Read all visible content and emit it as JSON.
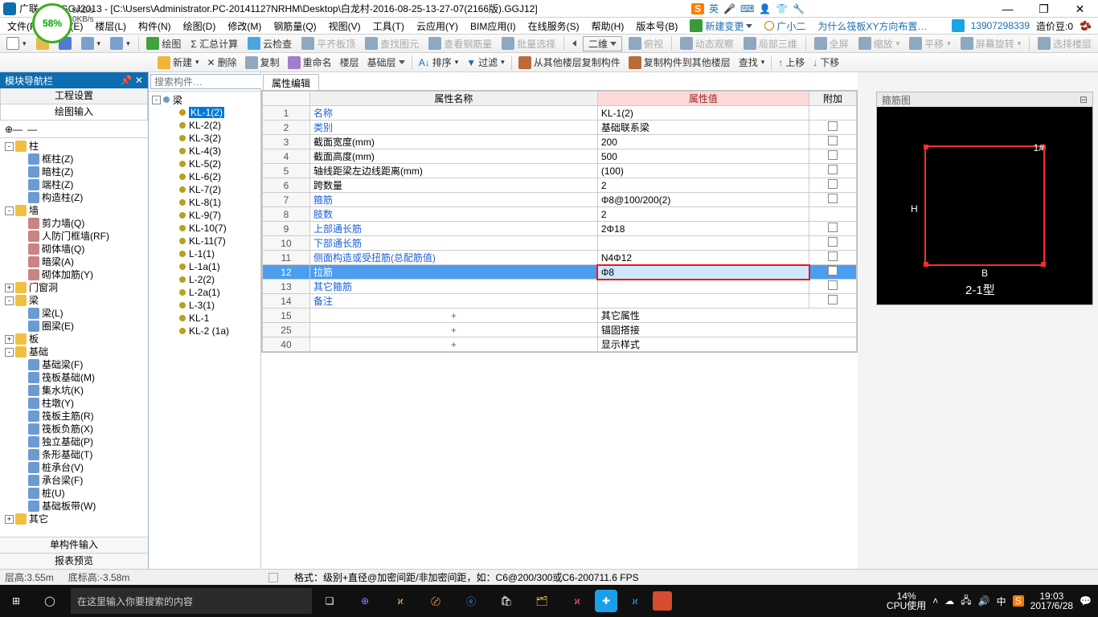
{
  "title": "广联…… GGJ2013 - [C:\\Users\\Administrator.PC-20141127NRHM\\Desktop\\白龙村-2016-08-25-13-27-07(2166版).GGJ12]",
  "speed": {
    "pct": "58%",
    "up": "0KB/s",
    "down": "0KB/s"
  },
  "ime": {
    "logo": "S",
    "lang": "英"
  },
  "menus": [
    "文件(F)",
    "编辑(E)",
    "楼层(L)",
    "构件(N)",
    "绘图(D)",
    "修改(M)",
    "钢筋量(Q)",
    "视图(V)",
    "工具(T)",
    "云应用(Y)",
    "BIM应用(I)",
    "在线服务(S)",
    "帮助(H)",
    "版本号(B)"
  ],
  "menu_actions": {
    "new": "新建变更",
    "user": "广小二",
    "tip": "为什么筏板XY方向布置…",
    "account": "13907298339",
    "credit": "造价豆:0"
  },
  "tb1": {
    "draw": "绘图",
    "sum": "Σ 汇总计算",
    "cloud": "云检查",
    "level": "平齐板顶",
    "find": "查找图元",
    "viewbar": "查看钢筋量",
    "batch": "批量选择",
    "mode": "二维",
    "top": "俯视",
    "dyn": "动态观察",
    "local3d": "局部三维",
    "full": "全屏",
    "zoom": "缩放",
    "pan": "平移",
    "rot": "屏幕旋转",
    "selfloor": "选择楼层"
  },
  "tb2": {
    "new": "新建",
    "del": "删除",
    "copy": "复制",
    "rename": "重命名",
    "floor": "楼层",
    "baselayer": "基础层",
    "sort": "排序",
    "filter": "过滤",
    "copyfrom": "从其他楼层复制构件",
    "copyto": "复制构件到其他楼层",
    "search": "查找",
    "up": "上移",
    "down": "下移"
  },
  "left_panel": {
    "title": "模块导航栏",
    "tab1": "工程设置",
    "tab2": "绘图输入",
    "bottom1": "单构件输入",
    "bottom2": "报表预览"
  },
  "tree": [
    {
      "lvl": 0,
      "exp": "-",
      "ico": "folder",
      "label": "柱"
    },
    {
      "lvl": 1,
      "ico": "obj",
      "label": "框柱(Z)"
    },
    {
      "lvl": 1,
      "ico": "obj",
      "label": "暗柱(Z)"
    },
    {
      "lvl": 1,
      "ico": "obj",
      "label": "端柱(Z)"
    },
    {
      "lvl": 1,
      "ico": "obj",
      "label": "构造柱(Z)"
    },
    {
      "lvl": 0,
      "exp": "-",
      "ico": "folder",
      "label": "墙"
    },
    {
      "lvl": 1,
      "ico": "p",
      "label": "剪力墙(Q)"
    },
    {
      "lvl": 1,
      "ico": "p",
      "label": "人防门框墙(RF)"
    },
    {
      "lvl": 1,
      "ico": "p",
      "label": "砌体墙(Q)"
    },
    {
      "lvl": 1,
      "ico": "p",
      "label": "暗梁(A)"
    },
    {
      "lvl": 1,
      "ico": "p",
      "label": "砌体加筋(Y)"
    },
    {
      "lvl": 0,
      "exp": "+",
      "ico": "folder",
      "label": "门窗洞"
    },
    {
      "lvl": 0,
      "exp": "-",
      "ico": "folder",
      "label": "梁"
    },
    {
      "lvl": 1,
      "ico": "obj",
      "label": "梁(L)"
    },
    {
      "lvl": 1,
      "ico": "obj",
      "label": "圈梁(E)"
    },
    {
      "lvl": 0,
      "exp": "+",
      "ico": "folder",
      "label": "板"
    },
    {
      "lvl": 0,
      "exp": "-",
      "ico": "folder",
      "label": "基础"
    },
    {
      "lvl": 1,
      "ico": "obj",
      "label": "基础梁(F)"
    },
    {
      "lvl": 1,
      "ico": "obj",
      "label": "筏板基础(M)"
    },
    {
      "lvl": 1,
      "ico": "obj",
      "label": "集水坑(K)"
    },
    {
      "lvl": 1,
      "ico": "obj",
      "label": "柱墩(Y)"
    },
    {
      "lvl": 1,
      "ico": "obj",
      "label": "筏板主筋(R)"
    },
    {
      "lvl": 1,
      "ico": "obj",
      "label": "筏板负筋(X)"
    },
    {
      "lvl": 1,
      "ico": "obj",
      "label": "独立基础(P)"
    },
    {
      "lvl": 1,
      "ico": "obj",
      "label": "条形基础(T)"
    },
    {
      "lvl": 1,
      "ico": "obj",
      "label": "桩承台(V)"
    },
    {
      "lvl": 1,
      "ico": "obj",
      "label": "承台梁(F)"
    },
    {
      "lvl": 1,
      "ico": "obj",
      "label": "桩(U)"
    },
    {
      "lvl": 1,
      "ico": "obj",
      "label": "基础板带(W)"
    },
    {
      "lvl": 0,
      "exp": "+",
      "ico": "folder",
      "label": "其它"
    }
  ],
  "mid": {
    "search_ph": "搜索构件…",
    "root": "梁",
    "items": [
      "KL-1(2)",
      "KL-2(2)",
      "KL-3(2)",
      "KL-4(3)",
      "KL-5(2)",
      "KL-6(2)",
      "KL-7(2)",
      "KL-8(1)",
      "KL-9(7)",
      "KL-10(7)",
      "KL-11(7)",
      "L-1(1)",
      "L-1a(1)",
      "L-2(2)",
      "L-2a(1)",
      "L-3(1)",
      "KL-1",
      "KL-2 (1a)"
    ],
    "sel": 0
  },
  "prop": {
    "tab": "属性编辑",
    "headers": {
      "name": "属性名称",
      "value": "属性值",
      "extra": "附加"
    },
    "rows": [
      {
        "n": "1",
        "name": "名称",
        "link": true,
        "val": "KL-1(2)",
        "chk": false
      },
      {
        "n": "2",
        "name": "类别",
        "link": true,
        "val": "基础联系梁",
        "chk": true
      },
      {
        "n": "3",
        "name": "截面宽度(mm)",
        "val": "200",
        "chk": true
      },
      {
        "n": "4",
        "name": "截面高度(mm)",
        "val": "500",
        "chk": true
      },
      {
        "n": "5",
        "name": "轴线距梁左边线距离(mm)",
        "val": "(100)",
        "chk": true
      },
      {
        "n": "6",
        "name": "跨数量",
        "val": "2",
        "chk": true
      },
      {
        "n": "7",
        "name": "箍筋",
        "link": true,
        "val": "Φ8@100/200(2)",
        "chk": true
      },
      {
        "n": "8",
        "name": "肢数",
        "link": true,
        "val": "2",
        "chk": false
      },
      {
        "n": "9",
        "name": "上部通长筋",
        "link": true,
        "val": "2Φ18",
        "chk": true
      },
      {
        "n": "10",
        "name": "下部通长筋",
        "link": true,
        "val": "",
        "chk": true
      },
      {
        "n": "11",
        "name": "侧面构造或受扭筋(总配筋值)",
        "link": true,
        "val": "N4Φ12",
        "chk": true
      },
      {
        "n": "12",
        "name": "拉筋",
        "link": true,
        "val": "Φ8",
        "chk": true,
        "sel": true,
        "red": true
      },
      {
        "n": "13",
        "name": "其它箍筋",
        "link": true,
        "val": "",
        "chk": true
      },
      {
        "n": "14",
        "name": "备注",
        "link": true,
        "val": "",
        "chk": true
      },
      {
        "n": "15",
        "name": "其它属性",
        "exp": "+"
      },
      {
        "n": "25",
        "name": "锚固搭接",
        "exp": "+"
      },
      {
        "n": "40",
        "name": "显示样式",
        "exp": "+"
      }
    ]
  },
  "diagram": {
    "title": "箍筋图",
    "mark1": "1#",
    "markH": "H",
    "markB": "B",
    "type": "2-1型"
  },
  "status": {
    "lh": "层高:3.55m",
    "bh": "底标高:-3.58m",
    "hint": "格式：级别+直径@加密间距/非加密间距，如：C6@200/300或C6-200",
    "fps": "711.6 FPS"
  },
  "taskbar": {
    "search": "在这里输入你要搜索的内容",
    "cpu": "14%",
    "cpul": "CPU使用",
    "time": "19:03",
    "date": "2017/6/28",
    "ime": "中"
  }
}
